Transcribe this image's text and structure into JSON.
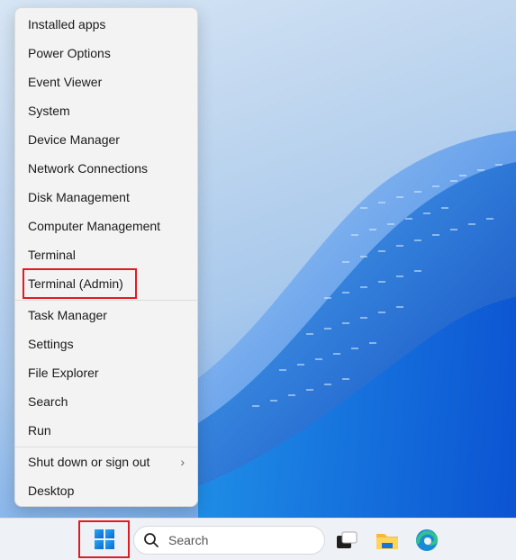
{
  "context_menu": {
    "groups": [
      {
        "items": [
          {
            "label": "Installed apps"
          },
          {
            "label": "Power Options"
          },
          {
            "label": "Event Viewer"
          },
          {
            "label": "System"
          },
          {
            "label": "Device Manager"
          },
          {
            "label": "Network Connections"
          },
          {
            "label": "Disk Management"
          },
          {
            "label": "Computer Management"
          },
          {
            "label": "Terminal"
          },
          {
            "label": "Terminal (Admin)",
            "highlighted": true
          }
        ]
      },
      {
        "items": [
          {
            "label": "Task Manager"
          },
          {
            "label": "Settings"
          },
          {
            "label": "File Explorer"
          },
          {
            "label": "Search"
          },
          {
            "label": "Run"
          }
        ]
      },
      {
        "items": [
          {
            "label": "Shut down or sign out",
            "submenu_icon": "chevron-right-icon",
            "submenu_glyph": "›"
          },
          {
            "label": "Desktop"
          }
        ]
      }
    ]
  },
  "taskbar": {
    "start_button": {
      "icon": "windows-logo-icon",
      "highlighted": true
    },
    "search": {
      "placeholder": "Search",
      "icon": "search-icon"
    },
    "apps": [
      {
        "name": "task-view-icon"
      },
      {
        "name": "file-explorer-icon"
      },
      {
        "name": "edge-icon"
      }
    ]
  },
  "colors": {
    "highlight": "#e11b22",
    "menu_background": "#f3f3f3",
    "accent_blue": "#0a67d1"
  }
}
